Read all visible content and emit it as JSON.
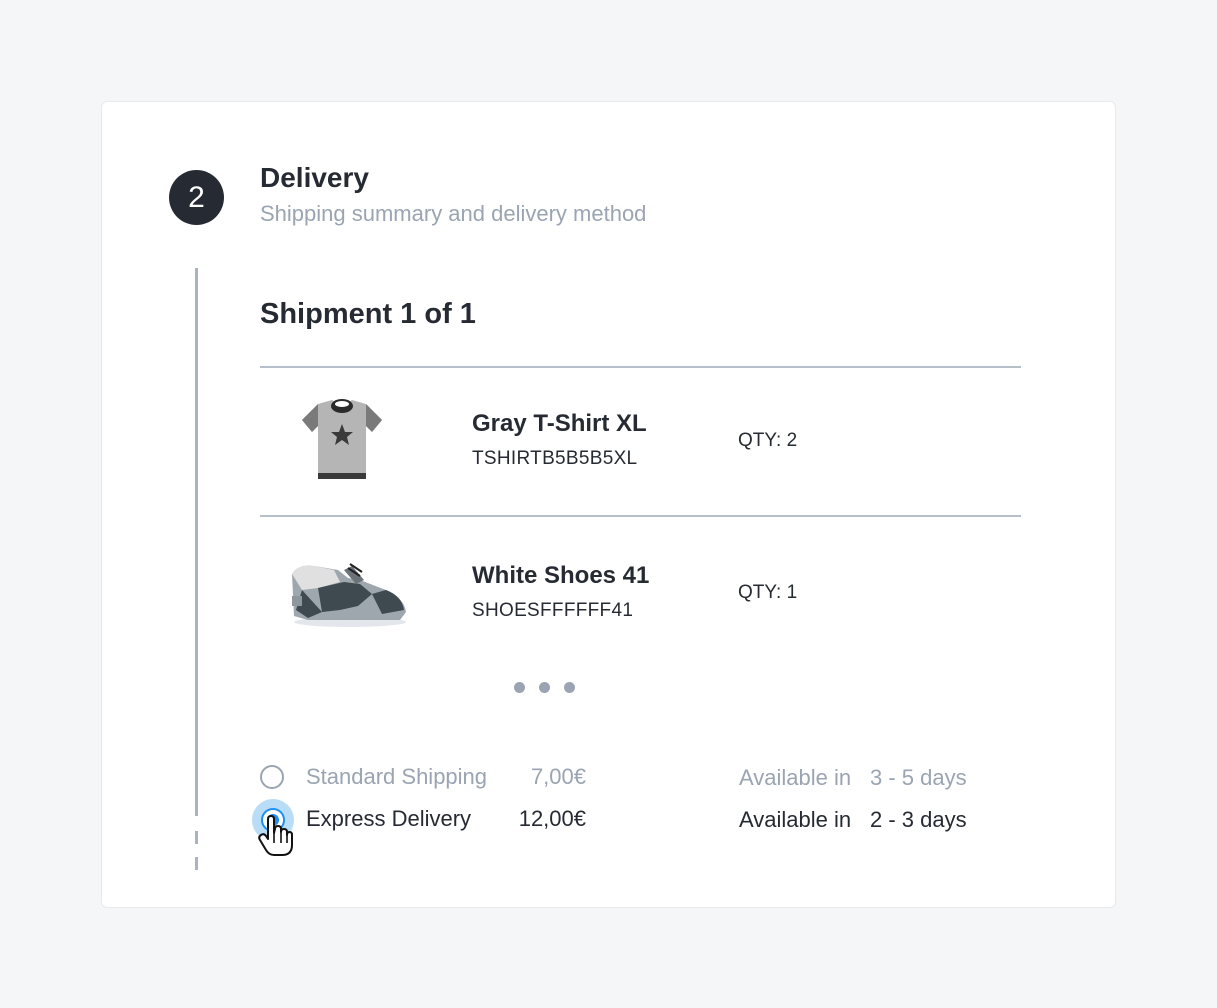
{
  "step": {
    "number": "2",
    "title": "Delivery",
    "subtitle": "Shipping summary and delivery method"
  },
  "shipment": {
    "title": "Shipment 1 of 1",
    "items": [
      {
        "name": "Gray T-Shirt XL",
        "sku": "TSHIRTB5B5B5XL",
        "qty": "QTY: 2",
        "icon": "tshirt-icon"
      },
      {
        "name": "White Shoes 41",
        "sku": "SHOESFFFFFF41",
        "qty": "QTY: 1",
        "icon": "shoe-icon"
      }
    ]
  },
  "delivery_options": [
    {
      "label": "Standard Shipping",
      "price": "7,00€",
      "available_label": "Available in",
      "days": "3 - 5 days",
      "selected": false
    },
    {
      "label": "Express Delivery",
      "price": "12,00€",
      "available_label": "Available in",
      "days": "2 - 3 days",
      "selected": true
    }
  ],
  "colors": {
    "accent": "#1f8ff0",
    "dark": "#262b33",
    "muted": "#9aa4b2",
    "background": "#f5f6f8"
  }
}
